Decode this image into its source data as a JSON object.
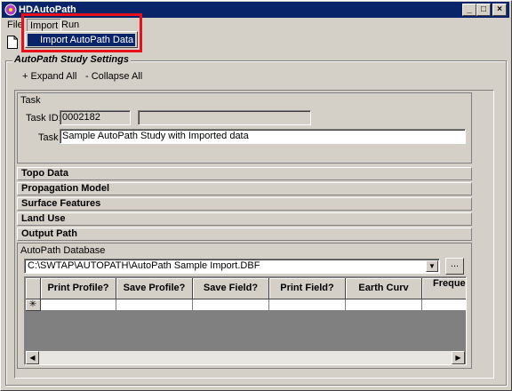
{
  "window": {
    "title": "HDAutoPath",
    "minimize": "_",
    "maximize": "□",
    "close": "×"
  },
  "menu": {
    "file": "File",
    "import": "Import",
    "run": "Run"
  },
  "dropdown": {
    "item": "Import AutoPath Data"
  },
  "group": {
    "title": "AutoPath Study Settings",
    "expand_all": "+ Expand All",
    "collapse_all": "- Collapse All"
  },
  "task": {
    "header": "Task",
    "id_label": "Task ID:",
    "id_value": "0002182",
    "id_extra": "",
    "task_label": "Task",
    "task_value": "Sample AutoPath Study with Imported data"
  },
  "sections": [
    "Topo Data",
    "Propagation Model",
    "Surface Features",
    "Land Use",
    "Output Path"
  ],
  "database": {
    "label": "AutoPath Database",
    "path": "C:\\SWTAP\\AUTOPATH\\AutoPath Sample Import.DBF",
    "browse": "..."
  },
  "grid": {
    "columns": [
      "Print Profile?",
      "Save Profile?",
      "Save Field?",
      "Print Field?",
      "Earth Curv",
      "Freque (MHz) (l"
    ],
    "new_row_marker": "✳"
  },
  "icons": {
    "app": "hdautopath-icon",
    "new": "new-document-icon"
  },
  "colors": {
    "titlebar": "#0a246a",
    "face": "#d4d0c8",
    "highlight": "#e8111b"
  }
}
